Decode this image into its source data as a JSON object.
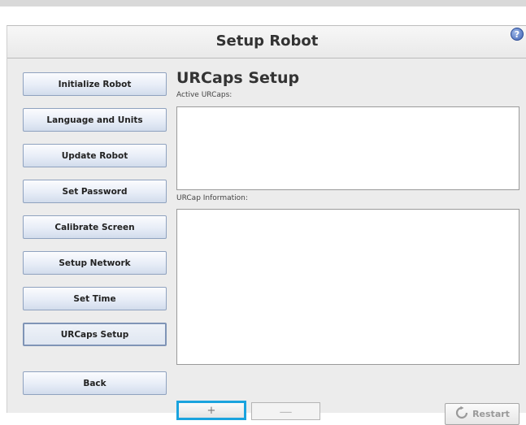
{
  "header": {
    "title": "Setup Robot",
    "help_icon": "help-icon"
  },
  "nav": {
    "initialize": "Initialize Robot",
    "language": "Language and Units",
    "update": "Update Robot",
    "password": "Set Password",
    "calibrate": "Calibrate Screen",
    "network": "Setup Network",
    "time": "Set Time",
    "urcaps": "URCaps Setup",
    "back": "Back"
  },
  "main": {
    "title": "URCaps Setup",
    "active_label": "Active URCaps:",
    "info_label": "URCap Information:"
  },
  "actions": {
    "add_glyph": "+",
    "remove_glyph": "—",
    "restart_label": "Restart"
  },
  "colors": {
    "selected_border": "#1aa3de",
    "help_blue": "#3f63b5"
  }
}
